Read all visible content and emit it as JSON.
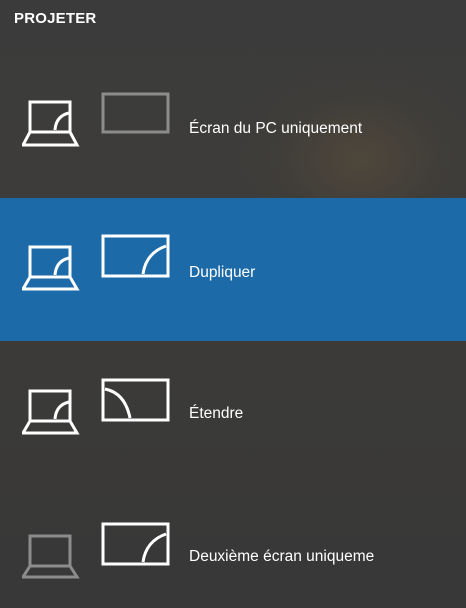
{
  "panel": {
    "title": "PROJETER",
    "accent_color": "#1c6aa8",
    "background_color": "#3a3a3a"
  },
  "options": [
    {
      "label": "Écran du PC uniquement",
      "icon": "pc-screen-only-icon",
      "selected": false
    },
    {
      "label": "Dupliquer",
      "icon": "duplicate-icon",
      "selected": true
    },
    {
      "label": "Étendre",
      "icon": "extend-icon",
      "selected": false
    },
    {
      "label": "Deuxième écran uniqueme",
      "icon": "second-screen-only-icon",
      "selected": false
    }
  ]
}
